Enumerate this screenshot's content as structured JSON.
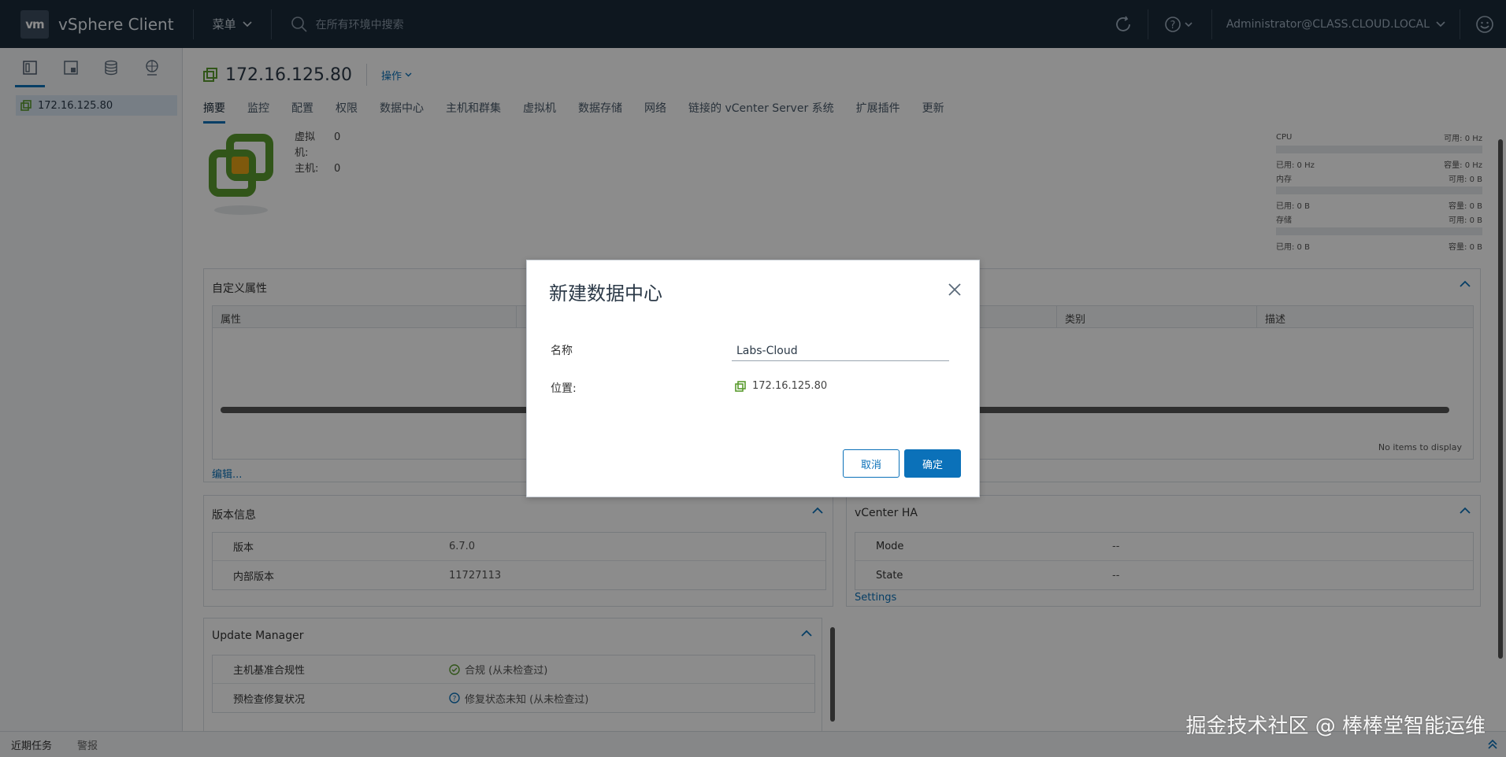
{
  "header": {
    "logo": "vm",
    "product": "vSphere Client",
    "menu_label": "菜单",
    "search_placeholder": "在所有环境中搜索",
    "user": "Administrator@CLASS.CLOUD.LOCAL"
  },
  "leftnav": {
    "tree": [
      {
        "label": "172.16.125.80"
      }
    ]
  },
  "page": {
    "title": "172.16.125.80",
    "actions": "操作",
    "tabs": [
      "摘要",
      "监控",
      "配置",
      "权限",
      "数据中心",
      "主机和群集",
      "虚拟机",
      "数据存储",
      "网络",
      "链接的 vCenter Server 系统",
      "扩展插件",
      "更新"
    ],
    "counts": {
      "vm_label": "虚拟机:",
      "vm_value": "0",
      "host_label": "主机:",
      "host_value": "0"
    }
  },
  "resources": {
    "cpu": {
      "name": "CPU",
      "free": "可用: 0 Hz",
      "used": "已用: 0 Hz",
      "cap": "容量: 0 Hz"
    },
    "memory": {
      "name": "内存",
      "free": "可用: 0 B",
      "used": "已用: 0 B",
      "cap": "容量: 0 B"
    },
    "storage": {
      "name": "存储",
      "free": "可用: 0 B",
      "used": "已用: 0 B",
      "cap": "容量: 0 B"
    }
  },
  "custom_attrs": {
    "title": "自定义属性",
    "col_attr": "属性",
    "col_cat": "类别",
    "col_desc": "描述",
    "empty": "No items to display",
    "edit": "编辑..."
  },
  "version": {
    "title": "版本信息",
    "rows": [
      {
        "k": "版本",
        "v": "6.7.0"
      },
      {
        "k": "内部版本",
        "v": "11727113"
      }
    ]
  },
  "vcenter_ha": {
    "title": "vCenter HA",
    "rows": [
      {
        "k": "Mode",
        "v": "--"
      },
      {
        "k": "State",
        "v": "--"
      }
    ],
    "settings": "Settings"
  },
  "update_manager": {
    "title": "Update Manager",
    "rows": [
      {
        "k": "主机基准合规性",
        "v": "合规 (从未检查过)"
      },
      {
        "k": "预检查修复状况",
        "v": "修复状态未知 (从未检查过)"
      }
    ]
  },
  "bottombar": {
    "tasks": "近期任务",
    "alarms": "警报"
  },
  "watermark": "掘金技术社区 @ 棒棒堂智能运维",
  "modal": {
    "title": "新建数据中心",
    "name_label": "名称",
    "name_value": "Labs-Cloud",
    "location_label": "位置:",
    "location_value": "172.16.125.80",
    "cancel": "取消",
    "ok": "确定"
  },
  "colors": {
    "accent": "#0b71b9",
    "header": "#1b2a3a"
  }
}
